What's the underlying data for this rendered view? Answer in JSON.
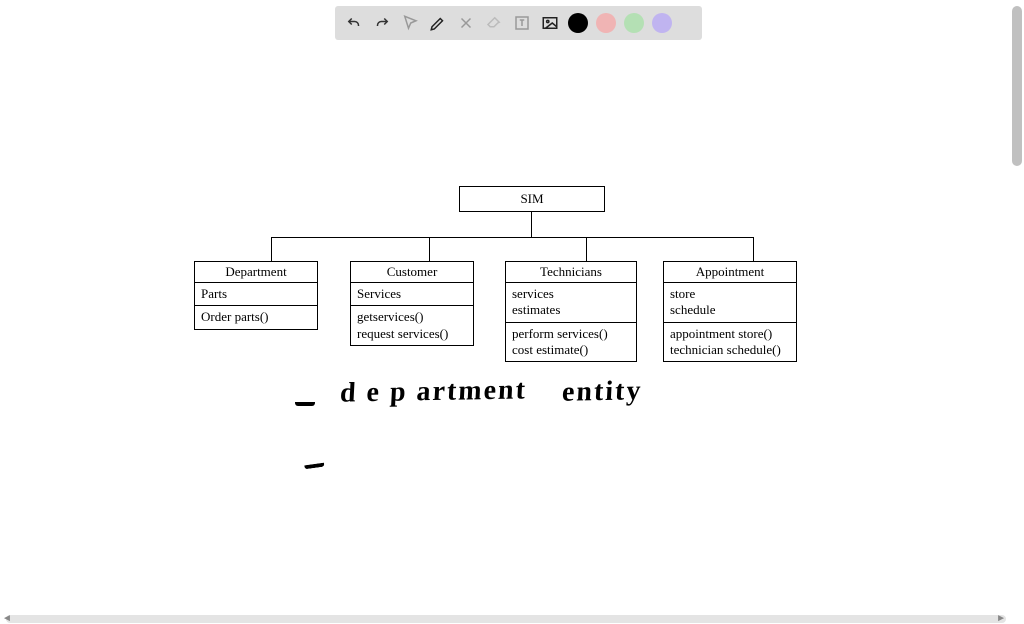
{
  "toolbar": {
    "tools": [
      "undo",
      "redo",
      "pointer",
      "pen",
      "tools",
      "eraser",
      "text",
      "image"
    ],
    "colors": [
      "black",
      "pink",
      "green",
      "purple"
    ]
  },
  "diagram": {
    "root": {
      "title": "SIM"
    },
    "children": [
      {
        "title": "Department",
        "attrs": "Parts",
        "ops": "Order parts()"
      },
      {
        "title": "Customer",
        "attrs": "Services",
        "ops": "getservices()\nrequest services()"
      },
      {
        "title": "Technicians",
        "attrs": "services\nestimates",
        "ops": "perform services()\ncost estimate()"
      },
      {
        "title": "Appointment",
        "attrs": "store\nschedule",
        "ops": "appointment store()\ntechnician schedule()"
      }
    ]
  },
  "handwriting": {
    "line1a": "d e p artment",
    "line1b": "entity"
  }
}
